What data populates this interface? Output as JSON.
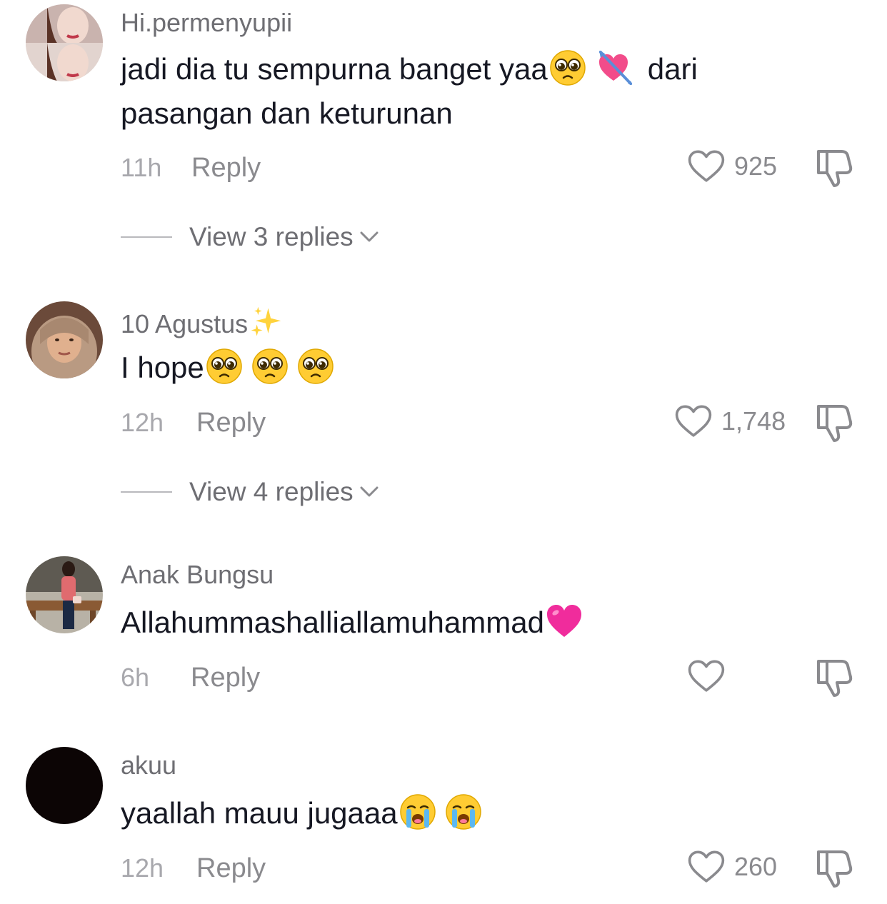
{
  "reply_label": "Reply",
  "comments": [
    {
      "username": "Hi.permenyupii",
      "text_part1": "jadi dia tu sempurna banget yaa",
      "text_part2": "dari",
      "text_part3": "pasangan dan keturunan",
      "emojis": [
        "pleading-face",
        "heart-with-arrow"
      ],
      "time": "11h",
      "likes": "925",
      "view_replies": "View 3 replies"
    },
    {
      "username": "10 Agustus",
      "username_emoji": "sparkles",
      "text": "I hope",
      "emojis": [
        "pleading-face",
        "pleading-face",
        "pleading-face"
      ],
      "time": "12h",
      "likes": "1,748",
      "view_replies": "View 4 replies"
    },
    {
      "username": "Anak Bungsu",
      "text": "Allahummashalliallamuhammad",
      "emojis": [
        "pink-heart"
      ],
      "time": "6h",
      "likes": ""
    },
    {
      "username": "akuu",
      "text": "yaallah mauu jugaaa",
      "emojis": [
        "loudly-crying-face",
        "loudly-crying-face"
      ],
      "time": "12h",
      "likes": "260"
    }
  ],
  "colors": {
    "username": "#6e6e73",
    "text": "#161823",
    "meta": "#a8a8ad",
    "icon": "#8a8a8e"
  }
}
